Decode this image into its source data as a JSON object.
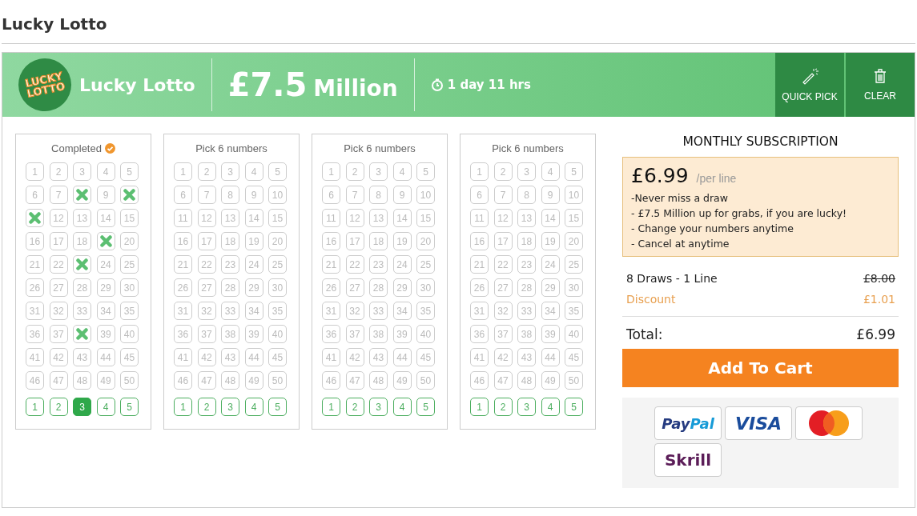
{
  "page_title": "Lucky Lotto",
  "banner": {
    "logo_lines": [
      "LUCKY",
      "LOTTO"
    ],
    "name": "Lucky Lotto",
    "jackpot_amount": "£7.5",
    "jackpot_unit": "Million",
    "countdown": "1 day 11 hrs",
    "actions": [
      {
        "kind": "quick-pick",
        "label": "QUICK PICK"
      },
      {
        "kind": "clear",
        "label": "CLEAR"
      }
    ]
  },
  "tickets": [
    {
      "title": "Completed",
      "completed": true,
      "numbers": [
        {
          "label": "1",
          "selected": false
        },
        {
          "label": "2",
          "selected": false
        },
        {
          "label": "3",
          "selected": false
        },
        {
          "label": "4",
          "selected": false
        },
        {
          "label": "5",
          "selected": false
        },
        {
          "label": "6",
          "selected": false
        },
        {
          "label": "7",
          "selected": false
        },
        {
          "selected": true
        },
        {
          "label": "9",
          "selected": false
        },
        {
          "selected": true
        },
        {
          "selected": true
        },
        {
          "label": "12",
          "selected": false
        },
        {
          "label": "13",
          "selected": false
        },
        {
          "label": "14",
          "selected": false
        },
        {
          "label": "15",
          "selected": false
        },
        {
          "label": "16",
          "selected": false
        },
        {
          "label": "17",
          "selected": false
        },
        {
          "label": "18",
          "selected": false
        },
        {
          "selected": true
        },
        {
          "label": "20",
          "selected": false
        },
        {
          "label": "21",
          "selected": false
        },
        {
          "label": "22",
          "selected": false
        },
        {
          "selected": true
        },
        {
          "label": "24",
          "selected": false
        },
        {
          "label": "25",
          "selected": false
        },
        {
          "label": "26",
          "selected": false
        },
        {
          "label": "27",
          "selected": false
        },
        {
          "label": "28",
          "selected": false
        },
        {
          "label": "29",
          "selected": false
        },
        {
          "label": "30",
          "selected": false
        },
        {
          "label": "31",
          "selected": false
        },
        {
          "label": "32",
          "selected": false
        },
        {
          "label": "33",
          "selected": false
        },
        {
          "label": "34",
          "selected": false
        },
        {
          "label": "35",
          "selected": false
        },
        {
          "label": "36",
          "selected": false
        },
        {
          "label": "37",
          "selected": false
        },
        {
          "selected": true
        },
        {
          "label": "39",
          "selected": false
        },
        {
          "label": "40",
          "selected": false
        },
        {
          "label": "41",
          "selected": false
        },
        {
          "label": "42",
          "selected": false
        },
        {
          "label": "43",
          "selected": false
        },
        {
          "label": "44",
          "selected": false
        },
        {
          "label": "45",
          "selected": false
        },
        {
          "label": "46",
          "selected": false
        },
        {
          "label": "47",
          "selected": false
        },
        {
          "label": "48",
          "selected": false
        },
        {
          "label": "49",
          "selected": false
        },
        {
          "label": "50",
          "selected": false
        }
      ],
      "bonus": [
        {
          "label": "1",
          "selected": false
        },
        {
          "label": "2",
          "selected": false
        },
        {
          "label": "3",
          "selected": true
        },
        {
          "label": "4",
          "selected": false
        },
        {
          "label": "5",
          "selected": false
        }
      ]
    },
    {
      "title": "Pick 6 numbers",
      "completed": false,
      "numbers": [
        {
          "label": "1",
          "selected": false
        },
        {
          "label": "2",
          "selected": false
        },
        {
          "label": "3",
          "selected": false
        },
        {
          "label": "4",
          "selected": false
        },
        {
          "label": "5",
          "selected": false
        },
        {
          "label": "6",
          "selected": false
        },
        {
          "label": "7",
          "selected": false
        },
        {
          "label": "8",
          "selected": false
        },
        {
          "label": "9",
          "selected": false
        },
        {
          "label": "10",
          "selected": false
        },
        {
          "label": "11",
          "selected": false
        },
        {
          "label": "12",
          "selected": false
        },
        {
          "label": "13",
          "selected": false
        },
        {
          "label": "14",
          "selected": false
        },
        {
          "label": "15",
          "selected": false
        },
        {
          "label": "16",
          "selected": false
        },
        {
          "label": "17",
          "selected": false
        },
        {
          "label": "18",
          "selected": false
        },
        {
          "label": "19",
          "selected": false
        },
        {
          "label": "20",
          "selected": false
        },
        {
          "label": "21",
          "selected": false
        },
        {
          "label": "22",
          "selected": false
        },
        {
          "label": "23",
          "selected": false
        },
        {
          "label": "24",
          "selected": false
        },
        {
          "label": "25",
          "selected": false
        },
        {
          "label": "26",
          "selected": false
        },
        {
          "label": "27",
          "selected": false
        },
        {
          "label": "28",
          "selected": false
        },
        {
          "label": "29",
          "selected": false
        },
        {
          "label": "30",
          "selected": false
        },
        {
          "label": "31",
          "selected": false
        },
        {
          "label": "32",
          "selected": false
        },
        {
          "label": "33",
          "selected": false
        },
        {
          "label": "34",
          "selected": false
        },
        {
          "label": "35",
          "selected": false
        },
        {
          "label": "36",
          "selected": false
        },
        {
          "label": "37",
          "selected": false
        },
        {
          "label": "38",
          "selected": false
        },
        {
          "label": "39",
          "selected": false
        },
        {
          "label": "40",
          "selected": false
        },
        {
          "label": "41",
          "selected": false
        },
        {
          "label": "42",
          "selected": false
        },
        {
          "label": "43",
          "selected": false
        },
        {
          "label": "44",
          "selected": false
        },
        {
          "label": "45",
          "selected": false
        },
        {
          "label": "46",
          "selected": false
        },
        {
          "label": "47",
          "selected": false
        },
        {
          "label": "48",
          "selected": false
        },
        {
          "label": "49",
          "selected": false
        },
        {
          "label": "50",
          "selected": false
        }
      ],
      "bonus": [
        {
          "label": "1",
          "selected": false
        },
        {
          "label": "2",
          "selected": false
        },
        {
          "label": "3",
          "selected": false
        },
        {
          "label": "4",
          "selected": false
        },
        {
          "label": "5",
          "selected": false
        }
      ]
    },
    {
      "title": "Pick 6 numbers",
      "completed": false,
      "numbers": [
        {
          "label": "1",
          "selected": false
        },
        {
          "label": "2",
          "selected": false
        },
        {
          "label": "3",
          "selected": false
        },
        {
          "label": "4",
          "selected": false
        },
        {
          "label": "5",
          "selected": false
        },
        {
          "label": "6",
          "selected": false
        },
        {
          "label": "7",
          "selected": false
        },
        {
          "label": "8",
          "selected": false
        },
        {
          "label": "9",
          "selected": false
        },
        {
          "label": "10",
          "selected": false
        },
        {
          "label": "11",
          "selected": false
        },
        {
          "label": "12",
          "selected": false
        },
        {
          "label": "13",
          "selected": false
        },
        {
          "label": "14",
          "selected": false
        },
        {
          "label": "15",
          "selected": false
        },
        {
          "label": "16",
          "selected": false
        },
        {
          "label": "17",
          "selected": false
        },
        {
          "label": "18",
          "selected": false
        },
        {
          "label": "19",
          "selected": false
        },
        {
          "label": "20",
          "selected": false
        },
        {
          "label": "21",
          "selected": false
        },
        {
          "label": "22",
          "selected": false
        },
        {
          "label": "23",
          "selected": false
        },
        {
          "label": "24",
          "selected": false
        },
        {
          "label": "25",
          "selected": false
        },
        {
          "label": "26",
          "selected": false
        },
        {
          "label": "27",
          "selected": false
        },
        {
          "label": "28",
          "selected": false
        },
        {
          "label": "29",
          "selected": false
        },
        {
          "label": "30",
          "selected": false
        },
        {
          "label": "31",
          "selected": false
        },
        {
          "label": "32",
          "selected": false
        },
        {
          "label": "33",
          "selected": false
        },
        {
          "label": "34",
          "selected": false
        },
        {
          "label": "35",
          "selected": false
        },
        {
          "label": "36",
          "selected": false
        },
        {
          "label": "37",
          "selected": false
        },
        {
          "label": "38",
          "selected": false
        },
        {
          "label": "39",
          "selected": false
        },
        {
          "label": "40",
          "selected": false
        },
        {
          "label": "41",
          "selected": false
        },
        {
          "label": "42",
          "selected": false
        },
        {
          "label": "43",
          "selected": false
        },
        {
          "label": "44",
          "selected": false
        },
        {
          "label": "45",
          "selected": false
        },
        {
          "label": "46",
          "selected": false
        },
        {
          "label": "47",
          "selected": false
        },
        {
          "label": "48",
          "selected": false
        },
        {
          "label": "49",
          "selected": false
        },
        {
          "label": "50",
          "selected": false
        }
      ],
      "bonus": [
        {
          "label": "1",
          "selected": false
        },
        {
          "label": "2",
          "selected": false
        },
        {
          "label": "3",
          "selected": false
        },
        {
          "label": "4",
          "selected": false
        },
        {
          "label": "5",
          "selected": false
        }
      ]
    },
    {
      "title": "Pick 6 numbers",
      "completed": false,
      "numbers": [
        {
          "label": "1",
          "selected": false
        },
        {
          "label": "2",
          "selected": false
        },
        {
          "label": "3",
          "selected": false
        },
        {
          "label": "4",
          "selected": false
        },
        {
          "label": "5",
          "selected": false
        },
        {
          "label": "6",
          "selected": false
        },
        {
          "label": "7",
          "selected": false
        },
        {
          "label": "8",
          "selected": false
        },
        {
          "label": "9",
          "selected": false
        },
        {
          "label": "10",
          "selected": false
        },
        {
          "label": "11",
          "selected": false
        },
        {
          "label": "12",
          "selected": false
        },
        {
          "label": "13",
          "selected": false
        },
        {
          "label": "14",
          "selected": false
        },
        {
          "label": "15",
          "selected": false
        },
        {
          "label": "16",
          "selected": false
        },
        {
          "label": "17",
          "selected": false
        },
        {
          "label": "18",
          "selected": false
        },
        {
          "label": "19",
          "selected": false
        },
        {
          "label": "20",
          "selected": false
        },
        {
          "label": "21",
          "selected": false
        },
        {
          "label": "22",
          "selected": false
        },
        {
          "label": "23",
          "selected": false
        },
        {
          "label": "24",
          "selected": false
        },
        {
          "label": "25",
          "selected": false
        },
        {
          "label": "26",
          "selected": false
        },
        {
          "label": "27",
          "selected": false
        },
        {
          "label": "28",
          "selected": false
        },
        {
          "label": "29",
          "selected": false
        },
        {
          "label": "30",
          "selected": false
        },
        {
          "label": "31",
          "selected": false
        },
        {
          "label": "32",
          "selected": false
        },
        {
          "label": "33",
          "selected": false
        },
        {
          "label": "34",
          "selected": false
        },
        {
          "label": "35",
          "selected": false
        },
        {
          "label": "36",
          "selected": false
        },
        {
          "label": "37",
          "selected": false
        },
        {
          "label": "38",
          "selected": false
        },
        {
          "label": "39",
          "selected": false
        },
        {
          "label": "40",
          "selected": false
        },
        {
          "label": "41",
          "selected": false
        },
        {
          "label": "42",
          "selected": false
        },
        {
          "label": "43",
          "selected": false
        },
        {
          "label": "44",
          "selected": false
        },
        {
          "label": "45",
          "selected": false
        },
        {
          "label": "46",
          "selected": false
        },
        {
          "label": "47",
          "selected": false
        },
        {
          "label": "48",
          "selected": false
        },
        {
          "label": "49",
          "selected": false
        },
        {
          "label": "50",
          "selected": false
        }
      ],
      "bonus": [
        {
          "label": "1",
          "selected": false
        },
        {
          "label": "2",
          "selected": false
        },
        {
          "label": "3",
          "selected": false
        },
        {
          "label": "4",
          "selected": false
        },
        {
          "label": "5",
          "selected": false
        }
      ]
    }
  ],
  "subscription": {
    "heading": "MONTHLY SUBSCRIPTION",
    "price": "£6.99",
    "price_unit": "/per line",
    "features": [
      "-Never miss a draw",
      "- £7.5 Million up for grabs, if you are lucky!",
      "- Change your numbers anytime",
      "- Cancel at anytime"
    ]
  },
  "summary": [
    {
      "kind": "base",
      "label": "8 Draws - 1 Line",
      "value": "£8.00"
    },
    {
      "kind": "discount",
      "label": "Discount",
      "value": "£1.01"
    }
  ],
  "total": {
    "label": "Total:",
    "value": "£6.99"
  },
  "cart_button": "Add To Cart",
  "payments": [
    {
      "kind": "paypal",
      "parts": [
        "Pay",
        "Pal"
      ]
    },
    {
      "kind": "visa",
      "text": "VISA"
    },
    {
      "kind": "mastercard"
    },
    {
      "kind": "skrill",
      "text": "Skrill"
    }
  ]
}
